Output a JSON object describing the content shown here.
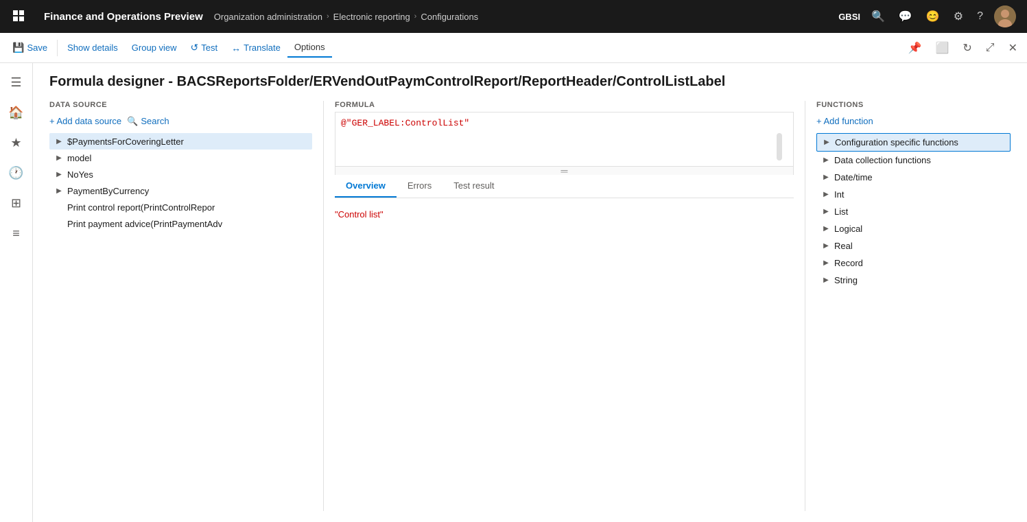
{
  "app": {
    "title": "Finance and Operations Preview",
    "org_badge": "GBSI"
  },
  "breadcrumb": {
    "items": [
      {
        "label": "Organization administration"
      },
      {
        "label": "Electronic reporting"
      },
      {
        "label": "Configurations"
      }
    ]
  },
  "toolbar": {
    "save_label": "Save",
    "show_details_label": "Show details",
    "group_view_label": "Group view",
    "test_label": "Test",
    "translate_label": "Translate",
    "options_label": "Options"
  },
  "page": {
    "title": "Formula designer - BACSReportsFolder/ERVendOutPaymControlReport/ReportHeader/ControlListLabel"
  },
  "datasource": {
    "header": "DATA SOURCE",
    "add_label": "+ Add data source",
    "search_label": "Search",
    "items": [
      {
        "id": "payments",
        "label": "$PaymentsForCoveringLetter",
        "expandable": true,
        "selected": true
      },
      {
        "id": "model",
        "label": "model",
        "expandable": true,
        "selected": false
      },
      {
        "id": "noyes",
        "label": "NoYes",
        "expandable": true,
        "selected": false
      },
      {
        "id": "paymentbycurrency",
        "label": "PaymentByCurrency",
        "expandable": true,
        "selected": false
      },
      {
        "id": "printcontrol",
        "label": "Print control report(PrintControlRepor",
        "expandable": false,
        "selected": false
      },
      {
        "id": "printpayment",
        "label": "Print payment advice(PrintPaymentAdv",
        "expandable": false,
        "selected": false
      }
    ]
  },
  "formula": {
    "label": "FORMULA",
    "value": "@\"GER_LABEL:ControlList\""
  },
  "results": {
    "tabs": [
      {
        "id": "overview",
        "label": "Overview",
        "active": true
      },
      {
        "id": "errors",
        "label": "Errors",
        "active": false
      },
      {
        "id": "testresult",
        "label": "Test result",
        "active": false
      }
    ],
    "overview_value": "\"Control list\""
  },
  "functions": {
    "header": "FUNCTIONS",
    "add_label": "+ Add function",
    "items": [
      {
        "id": "config",
        "label": "Configuration specific functions",
        "expandable": true,
        "selected": true
      },
      {
        "id": "datacollection",
        "label": "Data collection functions",
        "expandable": true,
        "selected": false
      },
      {
        "id": "datetime",
        "label": "Date/time",
        "expandable": true,
        "selected": false
      },
      {
        "id": "int",
        "label": "Int",
        "expandable": true,
        "selected": false
      },
      {
        "id": "list",
        "label": "List",
        "expandable": true,
        "selected": false
      },
      {
        "id": "logical",
        "label": "Logical",
        "expandable": true,
        "selected": false
      },
      {
        "id": "real",
        "label": "Real",
        "expandable": true,
        "selected": false
      },
      {
        "id": "record",
        "label": "Record",
        "expandable": true,
        "selected": false
      },
      {
        "id": "string",
        "label": "String",
        "expandable": true,
        "selected": false
      }
    ]
  }
}
